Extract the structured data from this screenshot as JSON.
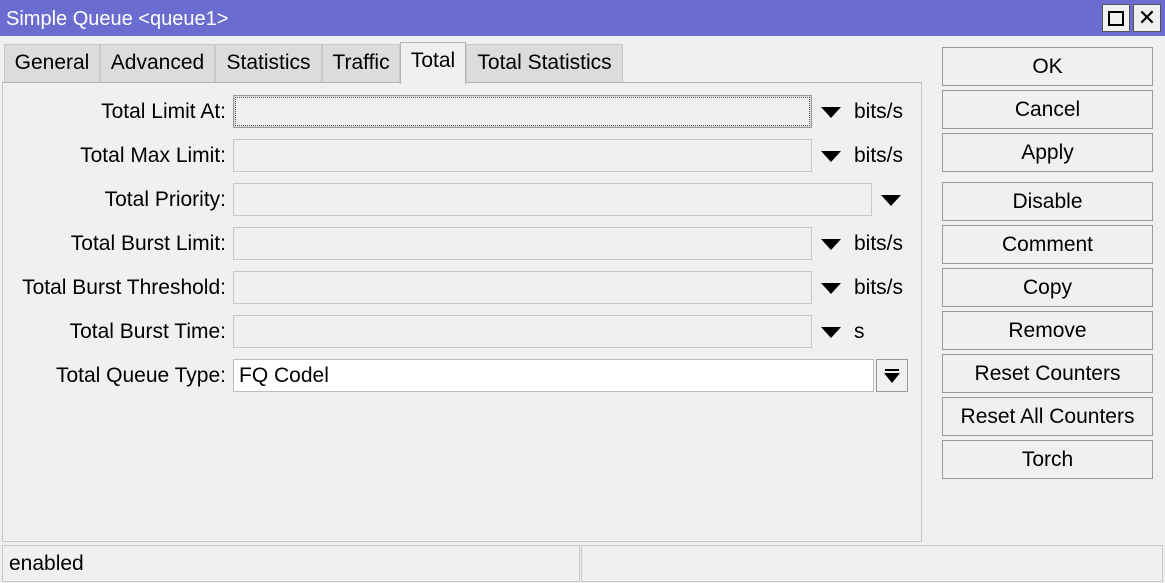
{
  "window": {
    "title": "Simple Queue <queue1>"
  },
  "tabs": [
    {
      "label": "General"
    },
    {
      "label": "Advanced"
    },
    {
      "label": "Statistics"
    },
    {
      "label": "Traffic"
    },
    {
      "label": "Total",
      "active": true
    },
    {
      "label": "Total Statistics"
    }
  ],
  "form": {
    "limit_at": {
      "label": "Total Limit At:",
      "value": "",
      "unit": "bits/s"
    },
    "max_limit": {
      "label": "Total Max Limit:",
      "value": "",
      "unit": "bits/s"
    },
    "priority": {
      "label": "Total Priority:",
      "value": ""
    },
    "burst_limit": {
      "label": "Total Burst Limit:",
      "value": "",
      "unit": "bits/s"
    },
    "burst_threshold": {
      "label": "Total Burst Threshold:",
      "value": "",
      "unit": "bits/s"
    },
    "burst_time": {
      "label": "Total Burst Time:",
      "value": "",
      "unit": "s"
    },
    "queue_type": {
      "label": "Total Queue Type:",
      "value": "FQ Codel"
    }
  },
  "actions": {
    "ok": "OK",
    "cancel": "Cancel",
    "apply": "Apply",
    "disable": "Disable",
    "comment": "Comment",
    "copy": "Copy",
    "remove": "Remove",
    "reset_counters": "Reset Counters",
    "reset_all_counters": "Reset All Counters",
    "torch": "Torch"
  },
  "status": {
    "state": "enabled",
    "extra": ""
  }
}
